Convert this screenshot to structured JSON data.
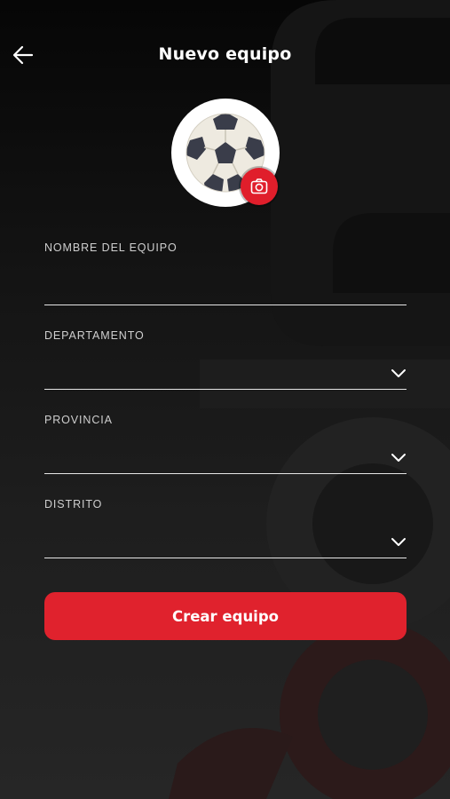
{
  "header": {
    "title": "Nuevo equipo",
    "back_icon": "arrow-left-icon"
  },
  "avatar": {
    "image_icon": "soccer-ball-icon",
    "camera_icon": "camera-icon"
  },
  "form": {
    "fields": [
      {
        "label": "NOMBRE DEL EQUIPO",
        "value": "",
        "type": "text"
      },
      {
        "label": "DEPARTAMENTO",
        "value": "",
        "type": "select",
        "icon": "chevron-down-icon"
      },
      {
        "label": "PROVINCIA",
        "value": "",
        "type": "select",
        "icon": "chevron-down-icon"
      },
      {
        "label": "DISTRITO",
        "value": "",
        "type": "select",
        "icon": "chevron-down-icon"
      }
    ],
    "submit_label": "Crear equipo"
  },
  "colors": {
    "accent": "#e0222d",
    "background": "#111111",
    "text": "#ffffff",
    "label": "#cfcfcf",
    "underline": "#e6e6e6"
  }
}
